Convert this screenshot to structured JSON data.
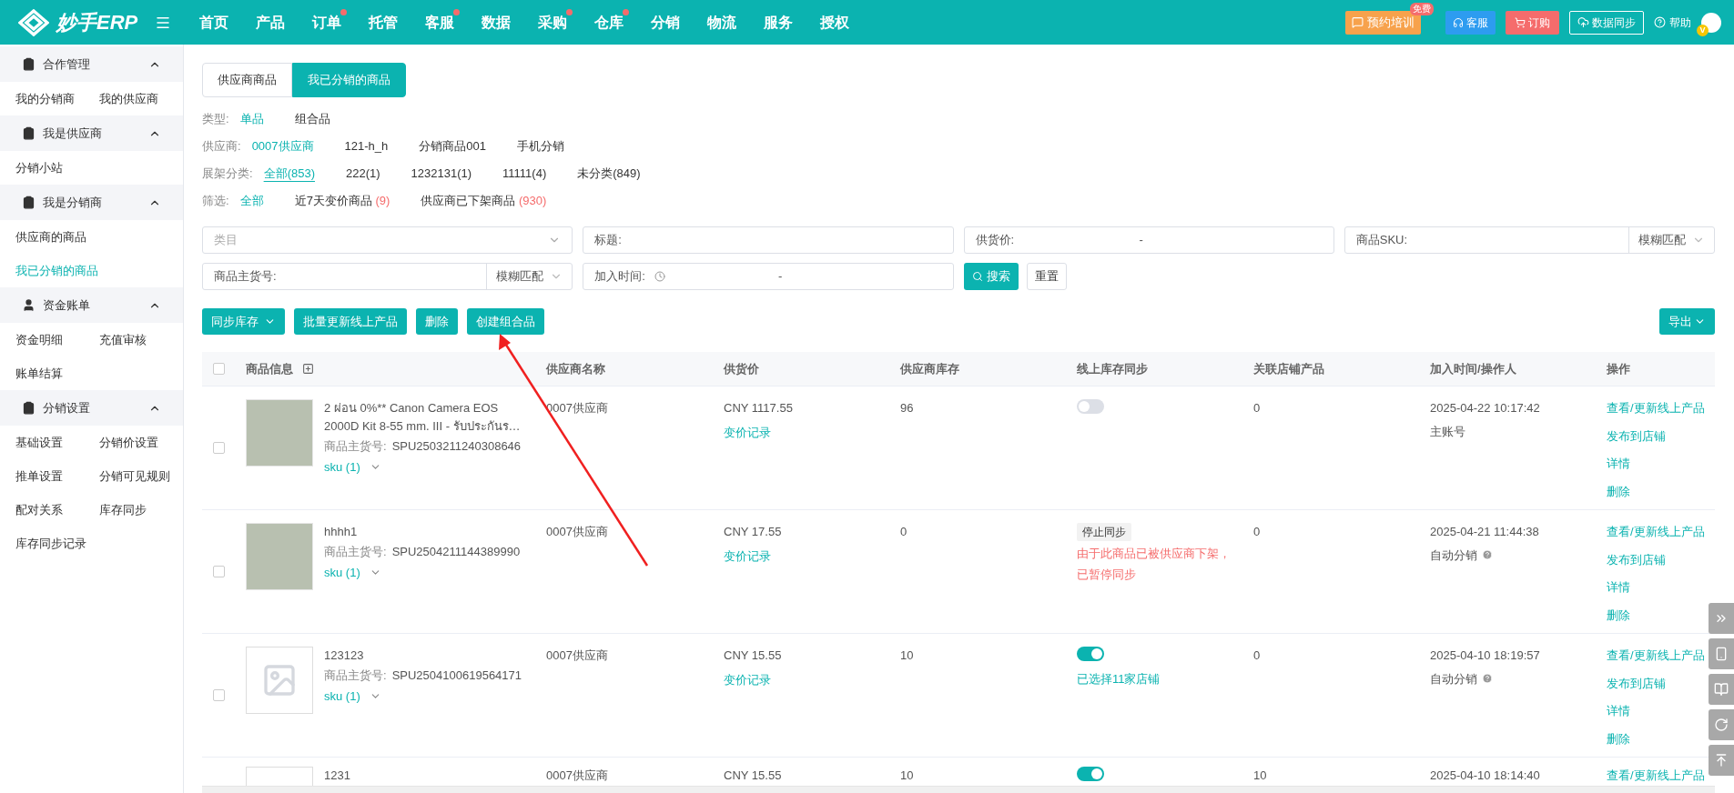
{
  "header": {
    "logo": "妙手ERP",
    "nav": [
      {
        "label": "首页",
        "dot": false
      },
      {
        "label": "产品",
        "dot": false
      },
      {
        "label": "订单",
        "dot": true
      },
      {
        "label": "托管",
        "dot": false
      },
      {
        "label": "客服",
        "dot": true
      },
      {
        "label": "数据",
        "dot": false
      },
      {
        "label": "采购",
        "dot": true
      },
      {
        "label": "仓库",
        "dot": true
      },
      {
        "label": "分销",
        "dot": false
      },
      {
        "label": "物流",
        "dot": false
      },
      {
        "label": "服务",
        "dot": false
      },
      {
        "label": "授权",
        "dot": false
      }
    ],
    "training": {
      "label": "预约培训",
      "badge": "免费"
    },
    "service": "客服",
    "order": "订购",
    "data_sync": "数据同步",
    "help": "帮助",
    "avatar_badge": "V"
  },
  "sidebar": {
    "groups": [
      {
        "title": "合作管理",
        "kind": "clipboard",
        "expanded": true,
        "items": [
          {
            "label": "我的分销商",
            "selected": false
          },
          {
            "label": "我的供应商",
            "selected": false
          }
        ]
      },
      {
        "title": "我是供应商",
        "kind": "clipboard",
        "expanded": true,
        "items": [
          {
            "label": "分销小站",
            "selected": false
          }
        ]
      },
      {
        "title": "我是分销商",
        "kind": "clipboard",
        "expanded": true,
        "items": [
          {
            "label": "供应商的商品",
            "selected": false
          },
          {
            "label": "我已分销的商品",
            "selected": true
          }
        ]
      },
      {
        "title": "资金账单",
        "kind": "person",
        "expanded": true,
        "items": [
          {
            "label": "资金明细",
            "selected": false
          },
          {
            "label": "充值审核",
            "selected": false
          },
          {
            "label": "账单结算",
            "selected": false
          }
        ]
      },
      {
        "title": "分销设置",
        "kind": "clipboard",
        "expanded": true,
        "items": [
          {
            "label": "基础设置",
            "selected": false
          },
          {
            "label": "分销价设置",
            "selected": false
          },
          {
            "label": "推单设置",
            "selected": false
          },
          {
            "label": "分销可见规则",
            "selected": false
          },
          {
            "label": "配对关系",
            "selected": false
          },
          {
            "label": "库存同步",
            "selected": false
          },
          {
            "label": "库存同步记录",
            "selected": false
          }
        ]
      }
    ]
  },
  "tabs": [
    {
      "label": "供应商商品",
      "selected": false
    },
    {
      "label": "我已分销的商品",
      "selected": true
    }
  ],
  "filters": [
    {
      "label": "类型:",
      "kind": "plain",
      "options": [
        {
          "label": "单品",
          "selected": true
        },
        {
          "label": "组合品",
          "selected": false
        }
      ]
    },
    {
      "label": "供应商:",
      "kind": "plain",
      "options": [
        {
          "label": "0007供应商",
          "selected": true
        },
        {
          "label": "121-h_h",
          "selected": false
        },
        {
          "label": "分销商品001",
          "selected": false
        },
        {
          "label": "手机分销",
          "selected": false
        }
      ]
    },
    {
      "label": "展架分类:",
      "kind": "link",
      "options": [
        {
          "label": "全部(853)",
          "selected": true
        },
        {
          "label": "222(1)",
          "selected": false
        },
        {
          "label": "1232131(1)",
          "selected": false
        },
        {
          "label": "11111(4)",
          "selected": false
        },
        {
          "label": "未分类(849)",
          "selected": false
        }
      ]
    },
    {
      "label": "筛选:",
      "kind": "plain",
      "options": [
        {
          "label": "全部",
          "selected": true
        },
        {
          "label": "近7天变价商品",
          "count": "(9)",
          "selected": false
        },
        {
          "label": "供应商已下架商品",
          "count": "(930)",
          "selected": false
        }
      ]
    }
  ],
  "search": {
    "category": {
      "placeholder": "类目"
    },
    "title": {
      "label": "标题:"
    },
    "price": {
      "label": "供货价:",
      "separator": "-"
    },
    "sku": {
      "label": "商品SKU:",
      "match": "模糊匹配"
    },
    "spu": {
      "label": "商品主货号:",
      "match": "模糊匹配"
    },
    "added": {
      "label": "加入时间:",
      "separator": "-"
    },
    "search_button": "搜索",
    "reset_button": "重置"
  },
  "toolbar": {
    "buttons": [
      {
        "label": "同步库存",
        "dropdown": true
      },
      {
        "label": "批量更新线上产品",
        "dropdown": false
      },
      {
        "label": "删除",
        "dropdown": false
      },
      {
        "label": "创建组合品",
        "dropdown": false
      }
    ],
    "export": "导出"
  },
  "table": {
    "select_all": {
      "checked": false
    },
    "columns": [
      "商品信息",
      "供应商名称",
      "供货价",
      "供应商库存",
      "线上库存同步",
      "关联店铺产品",
      "加入时间/操作人",
      "操作"
    ],
    "rows": [
      {
        "checked": false,
        "image": {
          "kind": "photo"
        },
        "title": "2 ผ่อน 0%** Canon Camera EOS 2000D Kit 8-55 mm. III - รับประกันร…",
        "spu_label": "商品主货号:",
        "spu": "SPU2503211240308646",
        "sku": "sku (1)",
        "supplier": "0007供应商",
        "price": "CNY 1117.55",
        "price_link": "变价记录",
        "stock": "96",
        "sync": {
          "kind": "toggle",
          "on": false
        },
        "shop": "0",
        "time": "2025-04-22 10:17:42",
        "operator": "主账号",
        "operator_help": false,
        "actions": [
          "查看/更新线上产品",
          "发布到店铺",
          "详情",
          "删除"
        ]
      },
      {
        "checked": false,
        "image": {
          "kind": "photo"
        },
        "title": "hhhh1",
        "spu_label": "商品主货号:",
        "spu": "SPU2504211144389990",
        "sku": "sku (1)",
        "supplier": "0007供应商",
        "price": "CNY 17.55",
        "price_link": "变价记录",
        "stock": "0",
        "sync": {
          "kind": "stopped",
          "tag": "停止同步",
          "note": "由于此商品已被供应商下架，已暂停同步"
        },
        "shop": "0",
        "time": "2025-04-21 11:44:38",
        "operator": "自动分销",
        "operator_help": true,
        "actions": [
          "查看/更新线上产品",
          "发布到店铺",
          "详情",
          "删除"
        ]
      },
      {
        "checked": false,
        "image": {
          "kind": "placeholder"
        },
        "title": "123123",
        "spu_label": "商品主货号:",
        "spu": "SPU2504100619564171",
        "sku": "sku (1)",
        "supplier": "0007供应商",
        "price": "CNY 15.55",
        "price_link": "变价记录",
        "stock": "10",
        "sync": {
          "kind": "toggle",
          "on": true,
          "note": "已选择11家店铺"
        },
        "shop": "0",
        "time": "2025-04-10 18:19:57",
        "operator": "自动分销",
        "operator_help": true,
        "actions": [
          "查看/更新线上产品",
          "发布到店铺",
          "详情",
          "删除"
        ]
      },
      {
        "image": {
          "kind": "blank"
        },
        "title": "1231",
        "supplier": "0007供应商",
        "price": "CNY 15.55",
        "stock": "10",
        "sync": {
          "kind": "toggle",
          "on": true
        },
        "shop": "10",
        "time": "2025-04-10 18:14:40",
        "actions": [
          "查看/更新线上产品"
        ]
      }
    ]
  }
}
